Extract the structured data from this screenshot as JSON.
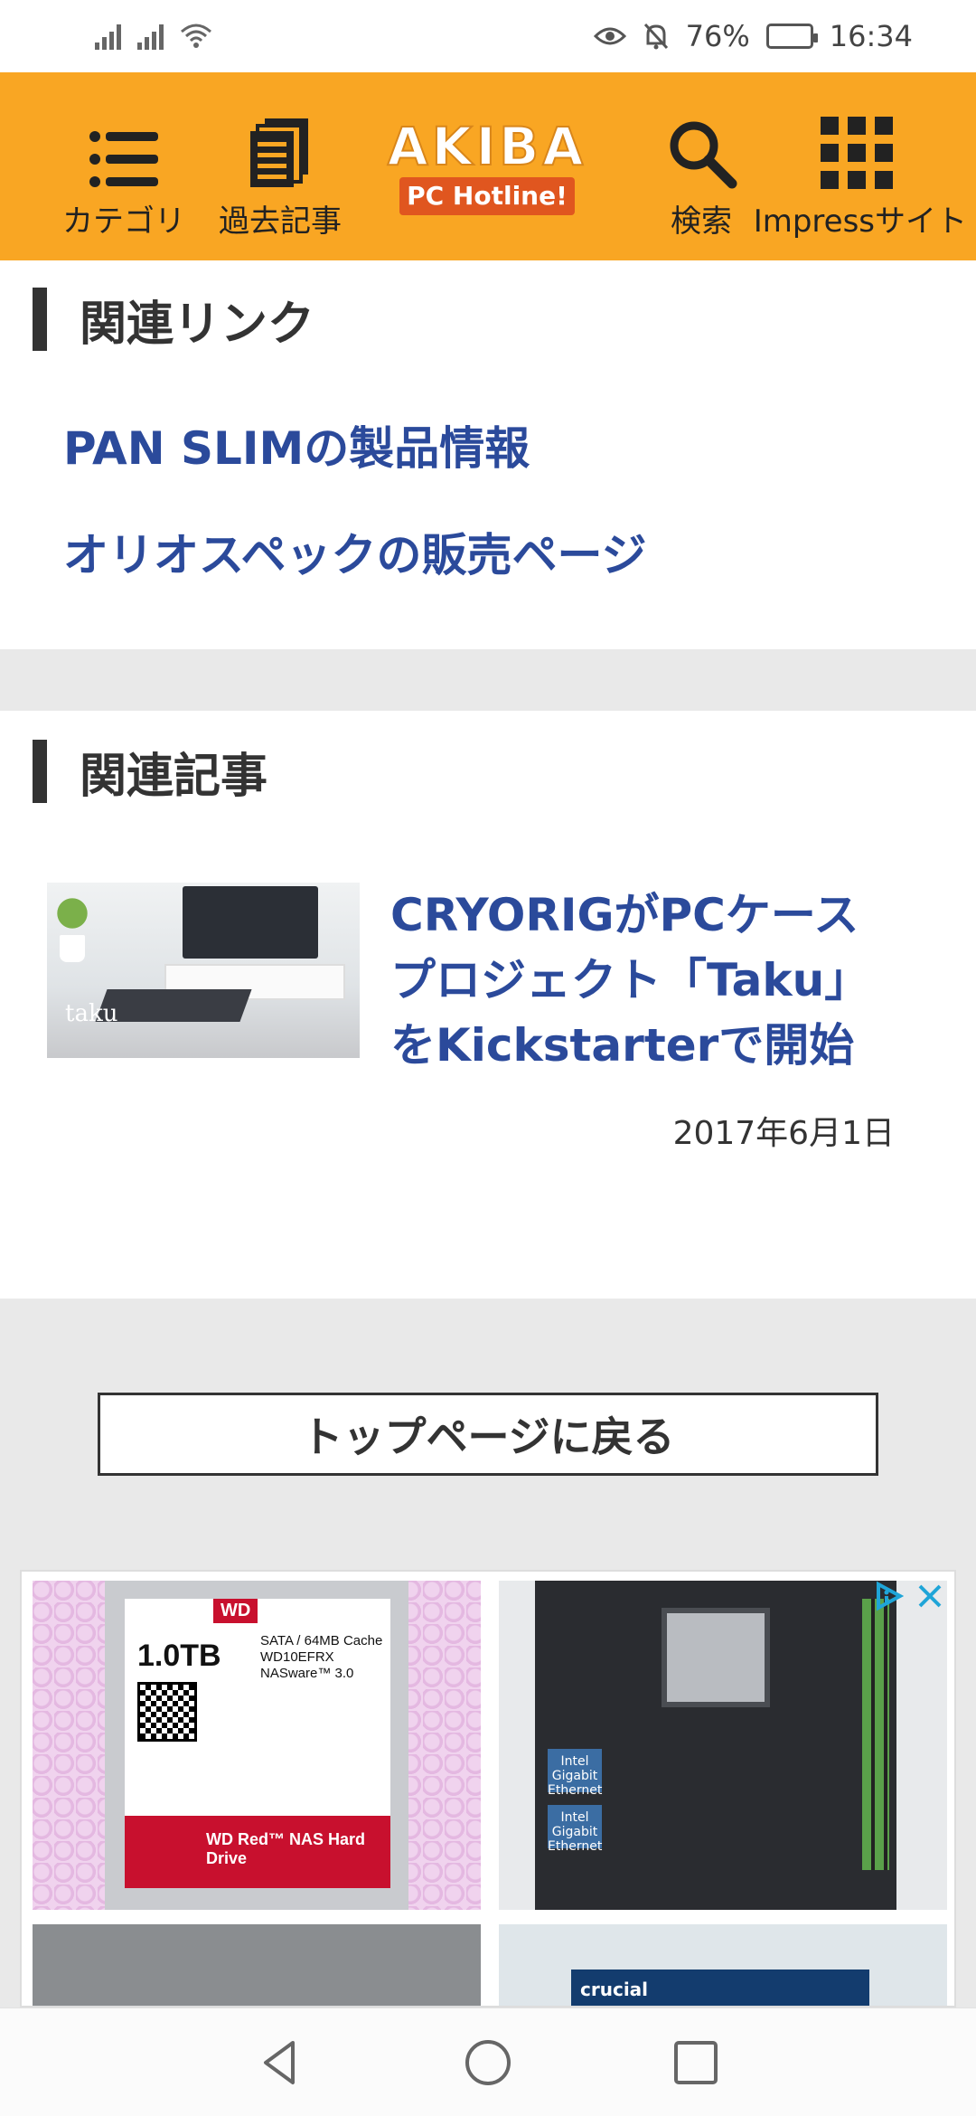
{
  "status_bar": {
    "battery": "76%",
    "battery_level": 0.76,
    "time": "16:34"
  },
  "header": {
    "category_label": "カテゴリ",
    "archive_label": "過去記事",
    "logo_top": "AKIBA",
    "logo_bottom": "PC Hotline!",
    "search_label": "検索",
    "impress_label": "Impressサイト",
    "accent_color": "#f9a623"
  },
  "related_links": {
    "heading": "関連リンク",
    "items": [
      "PAN SLIMの製品情報",
      "オリオスペックの販売ページ"
    ]
  },
  "related_articles": {
    "heading": "関連記事",
    "items": [
      {
        "title": "CRYORIGがPCケースプロジェクト「Taku」をKickstarterで開始",
        "date": "2017年6月1日",
        "thumb_text": "taku"
      }
    ]
  },
  "back_to_top": "トップページに戻る",
  "ad": {
    "hdd_brand": "WD",
    "hdd_capacity": "1.0TB",
    "hdd_spec": "SATA / 64MB Cache WD10EFRX NASware™ 3.0",
    "hdd_product": "WD Red™ NAS Hard Drive",
    "mb_eth1": "Intel Gigabit Ethernet",
    "mb_eth2": "Intel Gigabit Ethernet",
    "crucial_text": "crucial"
  }
}
